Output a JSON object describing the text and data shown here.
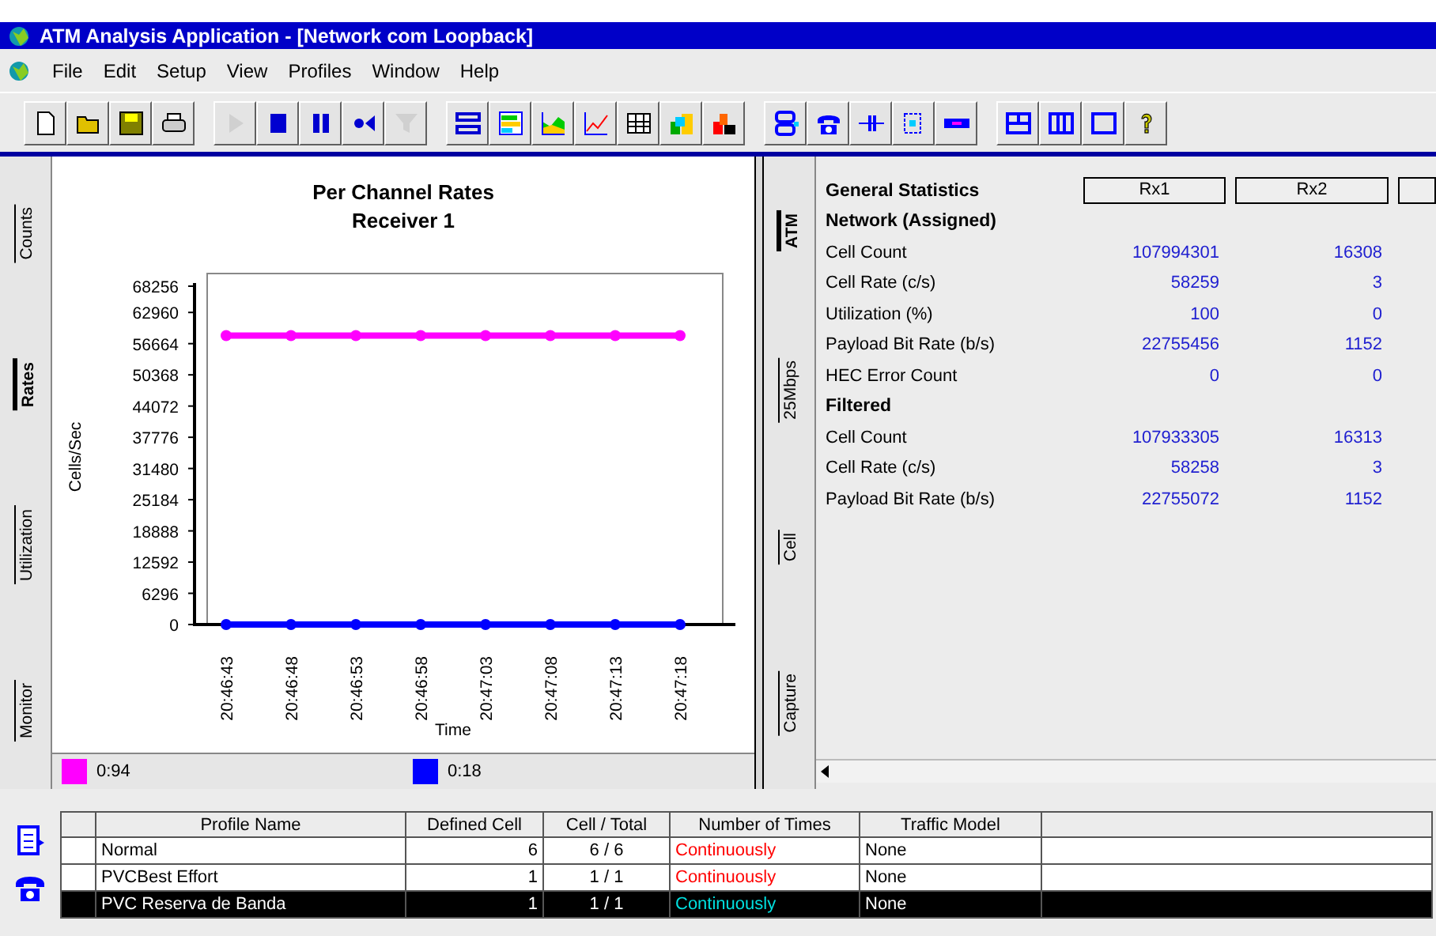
{
  "window": {
    "title": "ATM Analysis Application - [Network com Loopback]"
  },
  "menu": [
    "File",
    "Edit",
    "Setup",
    "View",
    "Profiles",
    "Window",
    "Help"
  ],
  "toolbar": [
    [
      {
        "kind": "new",
        "disabled": false
      },
      {
        "kind": "open",
        "disabled": false
      },
      {
        "kind": "save",
        "disabled": false
      },
      {
        "kind": "print",
        "disabled": false
      }
    ],
    [
      {
        "kind": "play",
        "disabled": true
      },
      {
        "kind": "stop",
        "disabled": false
      },
      {
        "kind": "pause",
        "disabled": false
      },
      {
        "kind": "step",
        "disabled": false
      },
      {
        "kind": "filter",
        "disabled": true
      }
    ],
    [
      {
        "kind": "rows",
        "disabled": false
      },
      {
        "kind": "bars",
        "disabled": false
      },
      {
        "kind": "area",
        "disabled": false
      },
      {
        "kind": "line",
        "disabled": false
      },
      {
        "kind": "grid",
        "disabled": false
      },
      {
        "kind": "blocks",
        "disabled": false
      },
      {
        "kind": "blocks2",
        "disabled": false
      }
    ],
    [
      {
        "kind": "stack",
        "disabled": false
      },
      {
        "kind": "phone",
        "disabled": false
      },
      {
        "kind": "link",
        "disabled": false
      },
      {
        "kind": "module",
        "disabled": false
      },
      {
        "kind": "dash",
        "disabled": false
      }
    ],
    [
      {
        "kind": "split2",
        "disabled": false
      },
      {
        "kind": "split3",
        "disabled": false
      },
      {
        "kind": "single",
        "disabled": false
      },
      {
        "kind": "help",
        "disabled": false
      }
    ]
  ],
  "chart_panel": {
    "tabs": [
      {
        "label": "Counts",
        "selected": false
      },
      {
        "label": "Rates",
        "selected": true
      },
      {
        "label": "Utilization",
        "selected": false
      },
      {
        "label": "Monitor",
        "selected": false
      }
    ],
    "subtitle": "Receiver 1",
    "chart_data": {
      "type": "line",
      "title": "Per Channel Rates",
      "xlabel": "Time",
      "ylabel": "Cells/Sec",
      "categories": [
        "20:46:43",
        "20:46:48",
        "20:46:53",
        "20:46:58",
        "20:47:03",
        "20:47:08",
        "20:47:13",
        "20:47:18"
      ],
      "series": [
        {
          "name": "0:94",
          "color": "#ff00ff",
          "marker": "circle",
          "values": [
            58300,
            58300,
            58300,
            58300,
            58300,
            58300,
            58300,
            58300
          ]
        },
        {
          "name": "0:18",
          "color": "#0000ff",
          "marker": "circle",
          "values": [
            0,
            0,
            0,
            0,
            0,
            0,
            0,
            0
          ]
        }
      ],
      "ylim": [
        0,
        68256
      ],
      "yticks": [
        0,
        6296,
        12592,
        18888,
        25184,
        31480,
        37776,
        44072,
        50368,
        56664,
        62960,
        68256
      ]
    }
  },
  "stats_panel": {
    "tabs": [
      {
        "label": "ATM",
        "selected": true
      },
      {
        "label": "25Mbps",
        "selected": false
      },
      {
        "label": "Cell",
        "selected": false
      },
      {
        "label": "Capture",
        "selected": false
      }
    ],
    "title": "General Statistics",
    "columns": [
      "Rx1",
      "Rx2"
    ],
    "sections": [
      {
        "title": "Network (Assigned)",
        "rows": [
          {
            "label": "Cell Count",
            "values": [
              "107994301",
              "16308"
            ]
          },
          {
            "label": "Cell Rate (c/s)",
            "values": [
              "58259",
              "3"
            ]
          },
          {
            "label": "Utilization (%)",
            "values": [
              "100",
              "0"
            ]
          },
          {
            "label": "Payload Bit Rate (b/s)",
            "values": [
              "22755456",
              "1152"
            ]
          },
          {
            "label": "HEC Error Count",
            "values": [
              "0",
              "0"
            ]
          }
        ]
      },
      {
        "title": "Filtered",
        "rows": [
          {
            "label": "Cell Count",
            "values": [
              "107933305",
              "16313"
            ]
          },
          {
            "label": "Cell Rate (c/s)",
            "values": [
              "58258",
              "3"
            ]
          },
          {
            "label": "Payload Bit Rate (b/s)",
            "values": [
              "22755072",
              "1152"
            ]
          }
        ]
      }
    ]
  },
  "profiles": {
    "columns": [
      "Profile Name",
      "Defined Cell",
      "Cell / Total",
      "Number of Times",
      "Traffic Model"
    ],
    "rows": [
      {
        "cells": [
          "Normal",
          "6",
          "6 / 6",
          "Continuously",
          "None"
        ],
        "selected": false
      },
      {
        "cells": [
          "PVCBest Effort",
          "1",
          "1 / 1",
          "Continuously",
          "None"
        ],
        "selected": false
      },
      {
        "cells": [
          "PVC Reserva de Banda",
          "1",
          "1 / 1",
          "Continuously",
          "None"
        ],
        "selected": true
      }
    ]
  }
}
